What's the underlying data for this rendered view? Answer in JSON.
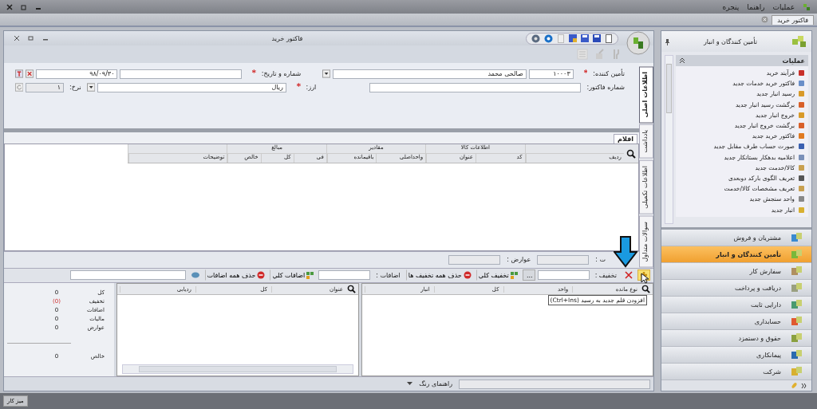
{
  "menu": [
    "عملیات",
    "راهنما",
    "پنجره"
  ],
  "doc_tab": {
    "label": "فاکتور خرید",
    "selected": true
  },
  "window": {
    "title": "فاکتور خرید"
  },
  "supplier": {
    "label": "تأمین کننده:",
    "required": true,
    "code": "۱۰۰۰۳",
    "name": "صالحی محمد"
  },
  "number_date": {
    "label": "شماره و تاریخ:",
    "required": true,
    "date": "۹۸/۰۹/۳۰"
  },
  "invoice_number": {
    "label": "شماره فاکتور:"
  },
  "currency": {
    "label": "ارز:",
    "required": true,
    "value": "ریال"
  },
  "rate": {
    "label": "نرخ:",
    "value": "۱",
    "disabled": true
  },
  "side_tabs": [
    {
      "label": "اطلاعات اصلی",
      "selected": true
    },
    {
      "label": "یادداشت",
      "selected": false
    },
    {
      "label": "اطلاعات تکمیلی",
      "selected": false
    },
    {
      "label": "سوالات متداول",
      "selected": false
    }
  ],
  "items_tab": {
    "label": "اقلام",
    "selected": true
  },
  "grid": {
    "groups": [
      {
        "columns": [
          "ردیف"
        ]
      },
      {
        "label": "اطلاعات کالا",
        "columns": [
          "کد",
          "عنوان"
        ]
      },
      {
        "label": "مقادیر",
        "columns": [
          "واحداصلی",
          "باقیمانده"
        ]
      },
      {
        "label": "مبالغ",
        "columns": [
          "فی",
          "کل",
          "خالص"
        ]
      },
      {
        "columns": [
          "توضیحات"
        ]
      }
    ]
  },
  "totals_row": [
    {
      "label": "ت :"
    },
    {
      "label": "عوارض :"
    }
  ],
  "line_toolbar": [
    {
      "kind": "add"
    },
    {
      "kind": "delete"
    },
    {
      "kind": "combo",
      "label": "تخفیف :"
    },
    {
      "kind": "more",
      "label": "..."
    },
    {
      "kind": "apply",
      "label": "تخفیف کلي"
    },
    {
      "kind": "remove",
      "label": "حذف همه تخفیف ها"
    },
    {
      "kind": "combo",
      "label": "اضافات :"
    },
    {
      "kind": "apply",
      "label": "اضافات کلي"
    },
    {
      "kind": "remove",
      "label": "حذف همه اضافات"
    },
    {
      "kind": "link"
    },
    {
      "kind": "field"
    }
  ],
  "tooltip": "افزودن قلم جدید به رسید (Ctrl+Ins)",
  "stock_grid": {
    "columns": [
      "نوع مانده",
      "واحد",
      "کل",
      "انبار"
    ]
  },
  "extras_grid": {
    "columns": [
      "عنوان",
      "کل",
      "ردیابی"
    ]
  },
  "summary": [
    {
      "kind": "value",
      "label": "کل",
      "value": "0"
    },
    {
      "kind": "negative",
      "label": "تخفیف",
      "value": "(0)"
    },
    {
      "kind": "value",
      "label": "اضافات",
      "value": "0"
    },
    {
      "kind": "value",
      "label": "مالیات",
      "value": "0"
    },
    {
      "kind": "value",
      "label": "عوارض",
      "value": "0"
    },
    {
      "kind": "total",
      "label": "خالص",
      "value": "0"
    }
  ],
  "status": {
    "color_guide": "راهنمای رنگ"
  },
  "sidebar": {
    "title": "تأمین کنندگان و انبار",
    "section": {
      "title": "عملیات",
      "expanded": true,
      "items": [
        "فرآیند خرید",
        "فاکتور خرید خدمات جدید",
        "رسید انبار جدید",
        "برگشت رسید انبار جدید",
        "خروج انبار جدید",
        "برگشت خروج انبار جدید",
        "فاکتور خرید جدید",
        "صورت حساب طرف مقابل جدید",
        "اعلامیه بدهکار بستانکار جدید",
        "کالا/خدمت جدید",
        "تعریف الگوی بارکد دوبعدی",
        "تعریف مشخصات کالا/خدمت",
        "واحد سنجش جدید",
        "انبار جدید"
      ]
    },
    "modules": [
      {
        "label": "مشتریان و فروش",
        "selected": false
      },
      {
        "label": "تأمین کنندگان و انبار",
        "selected": true
      },
      {
        "label": "سفارش کار",
        "selected": false
      },
      {
        "label": "دریافت و پرداخت",
        "selected": false
      },
      {
        "label": "دارایی ثابت",
        "selected": false
      },
      {
        "label": "حسابداری",
        "selected": false
      },
      {
        "label": "حقوق و دستمزد",
        "selected": false
      },
      {
        "label": "پیمانکاری",
        "selected": false
      },
      {
        "label": "شرکت",
        "selected": false
      }
    ]
  },
  "taskbar": {
    "button": "میز کار"
  }
}
